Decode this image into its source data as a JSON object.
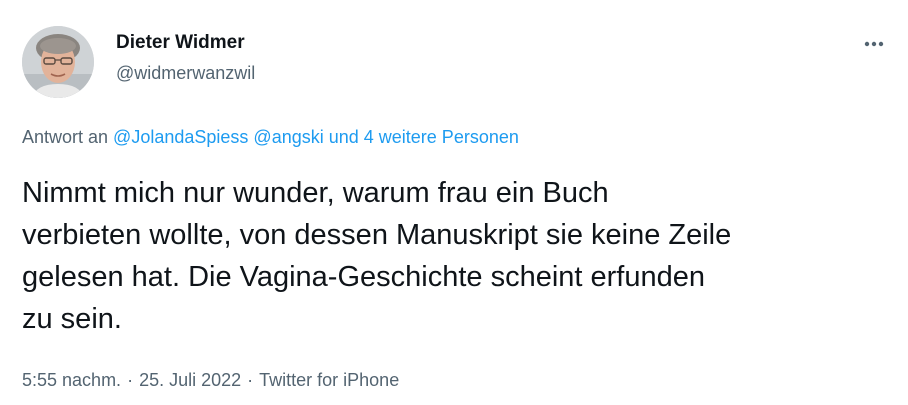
{
  "author": {
    "name": "Dieter Widmer",
    "handle": "@widmerwanzwil"
  },
  "more_icon": "more-horizontal-icon",
  "reply": {
    "prefix": "Antwort an ",
    "mention1": "@JolandaSpiess",
    "space": " ",
    "mention2": "@angski",
    "others": " und 4 weitere Personen"
  },
  "text_lines": [
    "Nimmt mich nur wunder, warum frau ein Buch",
    "verbieten wollte, von dessen Manuskript sie keine Zeile",
    "gelesen hat. Die Vagina-Geschichte scheint erfunden",
    "zu sein."
  ],
  "meta": {
    "time": "5:55 nachm.",
    "separator": "·",
    "date": "25. Juli 2022",
    "source": "Twitter for iPhone"
  },
  "colors": {
    "link": "#1d9bf0",
    "secondary_text": "#536471",
    "primary_text": "#0f1419"
  }
}
